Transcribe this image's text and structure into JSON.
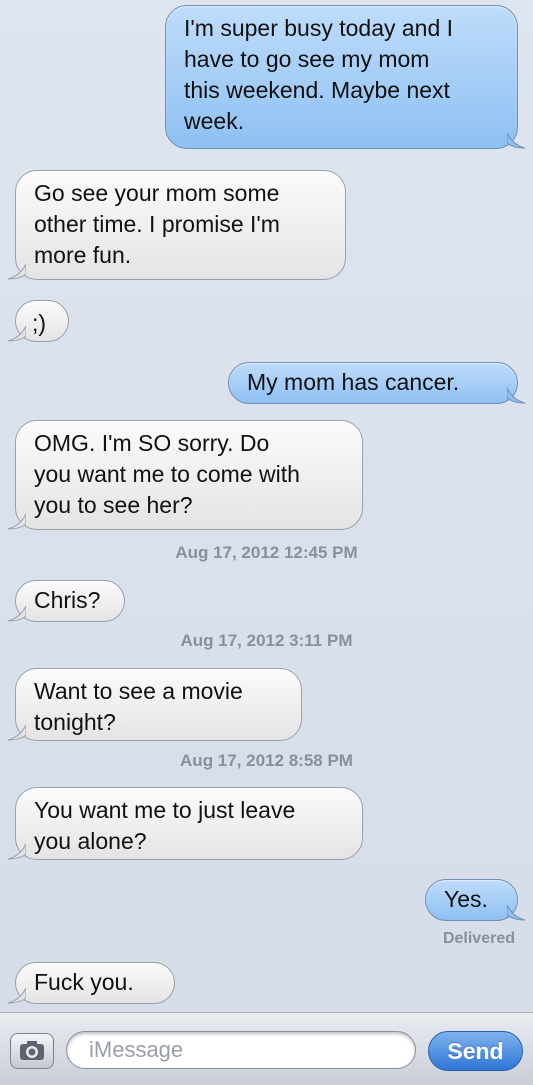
{
  "messages": [
    {
      "text": "I'm super busy today and I\nhave to go see my mom\nthis weekend. Maybe next\nweek."
    },
    {
      "text": "Go see your mom some\nother time. I promise I'm\nmore fun."
    },
    {
      "text": ";)"
    },
    {
      "text": "My mom has cancer."
    },
    {
      "text": "OMG. I'm SO sorry. Do\nyou want me to come with\nyou to see her?"
    },
    {
      "text": "Chris?"
    },
    {
      "text": "Want to see a movie\ntonight?"
    },
    {
      "text": "You want me to just leave\nyou alone?"
    },
    {
      "text": "Yes."
    },
    {
      "text": "Fuck you."
    }
  ],
  "timestamps": [
    "Aug 17, 2012 12:45 PM",
    "Aug 17, 2012 3:11 PM",
    "Aug 17, 2012 8:58 PM"
  ],
  "delivered_label": "Delivered",
  "composer": {
    "placeholder": "iMessage",
    "send_label": "Send",
    "camera_icon": "camera-icon"
  },
  "colors": {
    "outgoing_bubble": "#8ec0f3",
    "incoming_bubble": "#e4e4e4",
    "background": "#dbe2ed",
    "send_button": "#2f76d6"
  }
}
